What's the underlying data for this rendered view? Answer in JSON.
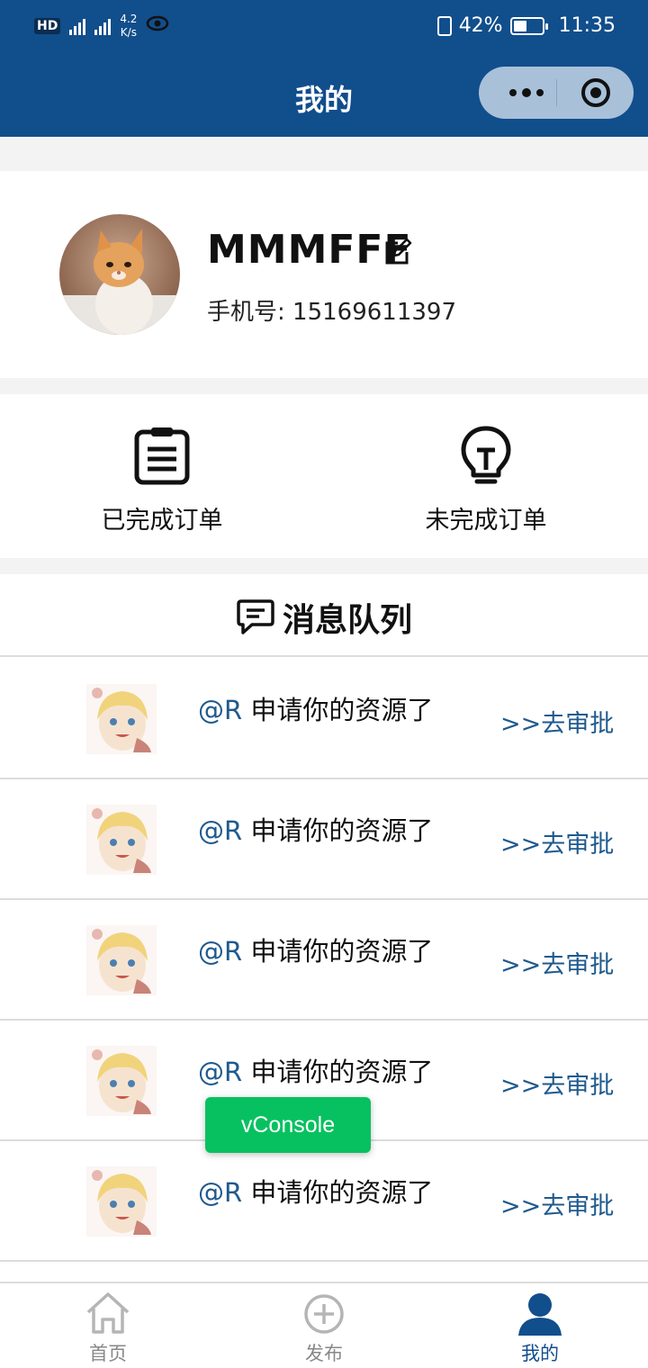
{
  "status_bar": {
    "hd_label": "HD",
    "net_speed_value": "4.2",
    "net_speed_unit": "K/s",
    "battery_percent": "42%",
    "time": "11:35"
  },
  "nav": {
    "title": "我的"
  },
  "profile": {
    "username": "MMMFFF",
    "phone_label": "手机号:",
    "phone_number": "15169611397"
  },
  "orders": {
    "completed_label": "已完成订单",
    "uncompleted_label": "未完成订单"
  },
  "messages": {
    "title": "消息队列",
    "items": [
      {
        "user": "@R",
        "text": " 申请你的资源了",
        "action": ">>去审批"
      },
      {
        "user": "@R",
        "text": " 申请你的资源了",
        "action": ">>去审批"
      },
      {
        "user": "@R",
        "text": " 申请你的资源了",
        "action": ">>去审批"
      },
      {
        "user": "@R",
        "text": " 申请你的资源了",
        "action": ">>去审批"
      },
      {
        "user": "@R",
        "text": " 申请你的资源了",
        "action": ">>去审批"
      }
    ]
  },
  "vconsole": {
    "label": "vConsole"
  },
  "tabbar": {
    "home_label": "首页",
    "publish_label": "发布",
    "mine_label": "我的"
  },
  "colors": {
    "brand": "#114e8c",
    "link": "#1f5a8e",
    "vconsole": "#07c160"
  }
}
